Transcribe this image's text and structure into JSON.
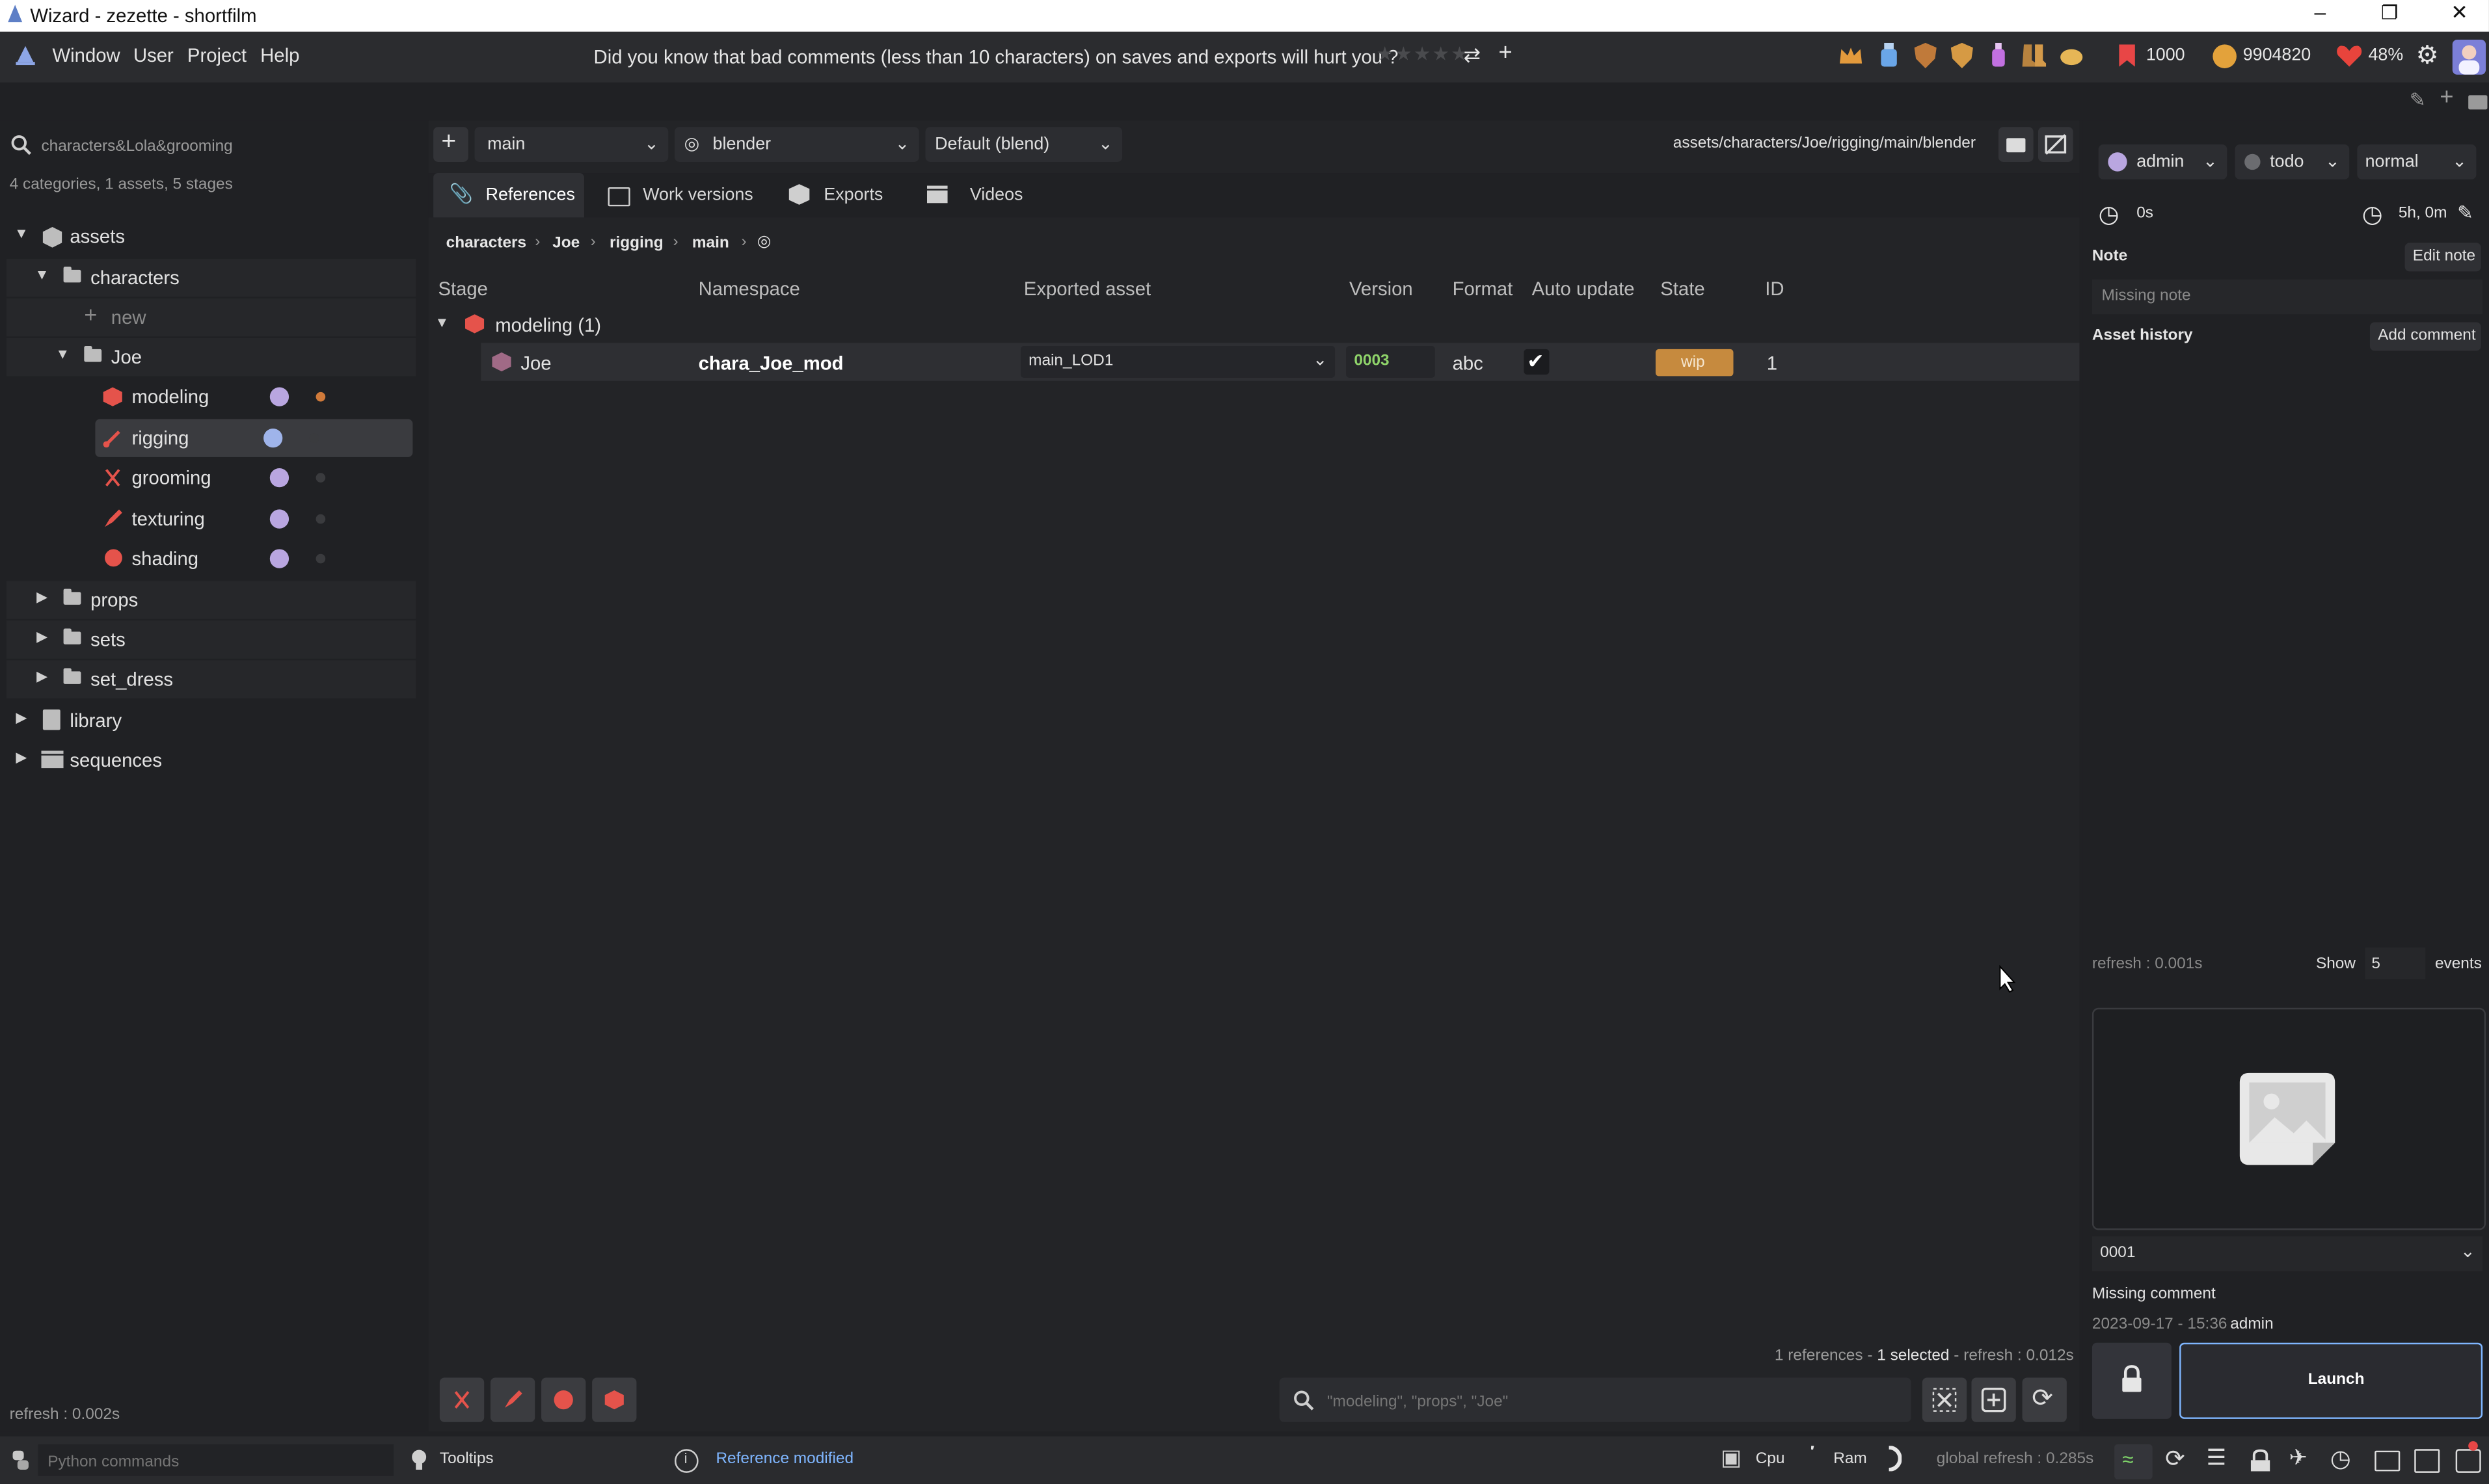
{
  "window": {
    "title": "Wizard - zezette - shortfilm"
  },
  "menu": {
    "items": [
      "Window",
      "User",
      "Project",
      "Help"
    ]
  },
  "tip": {
    "text": "Did you know that bad comments (less than 10 characters) on saves and exports will hurt you ?"
  },
  "stats": {
    "flags": "1000",
    "coins": "9904820",
    "life": "48%"
  },
  "sidebar": {
    "search_value": "characters&Lola&grooming",
    "summary": "4 categories, 1 assets, 5 stages",
    "tree": {
      "assets": "assets",
      "characters": "characters",
      "new": "new",
      "joe": "Joe",
      "stages": [
        "modeling",
        "rigging",
        "grooming",
        "texturing",
        "shading"
      ],
      "props": "props",
      "sets": "sets",
      "set_dress": "set_dress",
      "library": "library",
      "sequences": "sequences"
    },
    "refresh": "refresh : 0.002s"
  },
  "toolbar": {
    "variant": "main",
    "software": "blender",
    "extension": "Default (blend)",
    "path": "assets/characters/Joe/rigging/main/blender"
  },
  "tabs": [
    "References",
    "Work versions",
    "Exports",
    "Videos"
  ],
  "breadcrumb": [
    "characters",
    "Joe",
    "rigging",
    "main"
  ],
  "table": {
    "headers": [
      "Stage",
      "Namespace",
      "Exported asset",
      "Version",
      "Format",
      "Auto update",
      "State",
      "ID"
    ],
    "group": "modeling (1)",
    "row": {
      "stage": "Joe",
      "namespace": "chara_Joe_mod",
      "exported_asset": "main_LOD1",
      "version": "0003",
      "format": "abc",
      "auto_update": true,
      "state": "wip",
      "id": "1"
    }
  },
  "center_footer": {
    "references": "1 references - ",
    "selected": "1 selected",
    "refresh": " - refresh : 0.012s",
    "search_placeholder": "\"modeling\", \"props\", \"Joe\""
  },
  "right": {
    "user": "admin",
    "status": "todo",
    "priority": "normal",
    "time_spent": "0s",
    "estimated": "5h, 0m",
    "note_title": "Note",
    "edit_note": "Edit note",
    "note_placeholder": "Missing note",
    "history_title": "Asset history",
    "add_comment": "Add comment",
    "refresh": "refresh : 0.001s",
    "show_label": "Show",
    "show_value": "5",
    "events_label": "events",
    "version": "0001",
    "comment": "Missing comment",
    "date": "2023-09-17 - 15:36",
    "author": "admin",
    "launch": "Launch"
  },
  "status": {
    "python_placeholder": "Python commands",
    "tooltips": "Tooltips",
    "message": "Reference modified",
    "cpu": "Cpu",
    "ram": "Ram",
    "global_refresh": "global refresh : 0.285s"
  },
  "colors": {
    "accent": "#7fb6ff",
    "wip": "#c68a3e",
    "modeling": "#e5534b",
    "version": "#8fd46a"
  }
}
